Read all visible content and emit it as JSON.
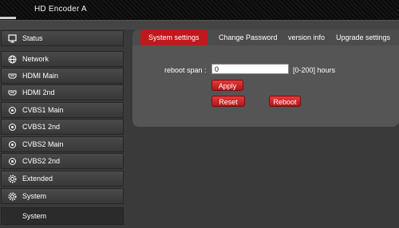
{
  "header": {
    "title": "HD Encoder  A"
  },
  "sidebar": {
    "items": [
      {
        "label": "Status",
        "icon": "monitor-icon"
      },
      {
        "label": "Network",
        "icon": "globe-icon"
      },
      {
        "label": "HDMI Main",
        "icon": "hdmi-icon"
      },
      {
        "label": "HDMI 2nd",
        "icon": "hdmi-icon"
      },
      {
        "label": "CVBS1 Main",
        "icon": "cvbs-icon"
      },
      {
        "label": "CVBS1 2nd",
        "icon": "cvbs-icon"
      },
      {
        "label": "CVBS2 Main",
        "icon": "cvbs-icon"
      },
      {
        "label": "CVBS2 2nd",
        "icon": "cvbs-icon"
      },
      {
        "label": "Extended",
        "icon": "gear-icon"
      },
      {
        "label": "System",
        "icon": "gear-icon"
      }
    ],
    "sub_item": "System"
  },
  "tabs": [
    {
      "label": "System settings",
      "active": true
    },
    {
      "label": "Change Password",
      "active": false
    },
    {
      "label": "version info",
      "active": false
    },
    {
      "label": "Upgrade settings",
      "active": false
    }
  ],
  "form": {
    "reboot_label": "reboot span :",
    "reboot_value": "0",
    "range_text": "[0-200] hours",
    "apply_label": "Apply",
    "reset_label": "Reset",
    "reboot_label_btn": "Reboot"
  },
  "colors": {
    "accent": "#c0191d"
  }
}
